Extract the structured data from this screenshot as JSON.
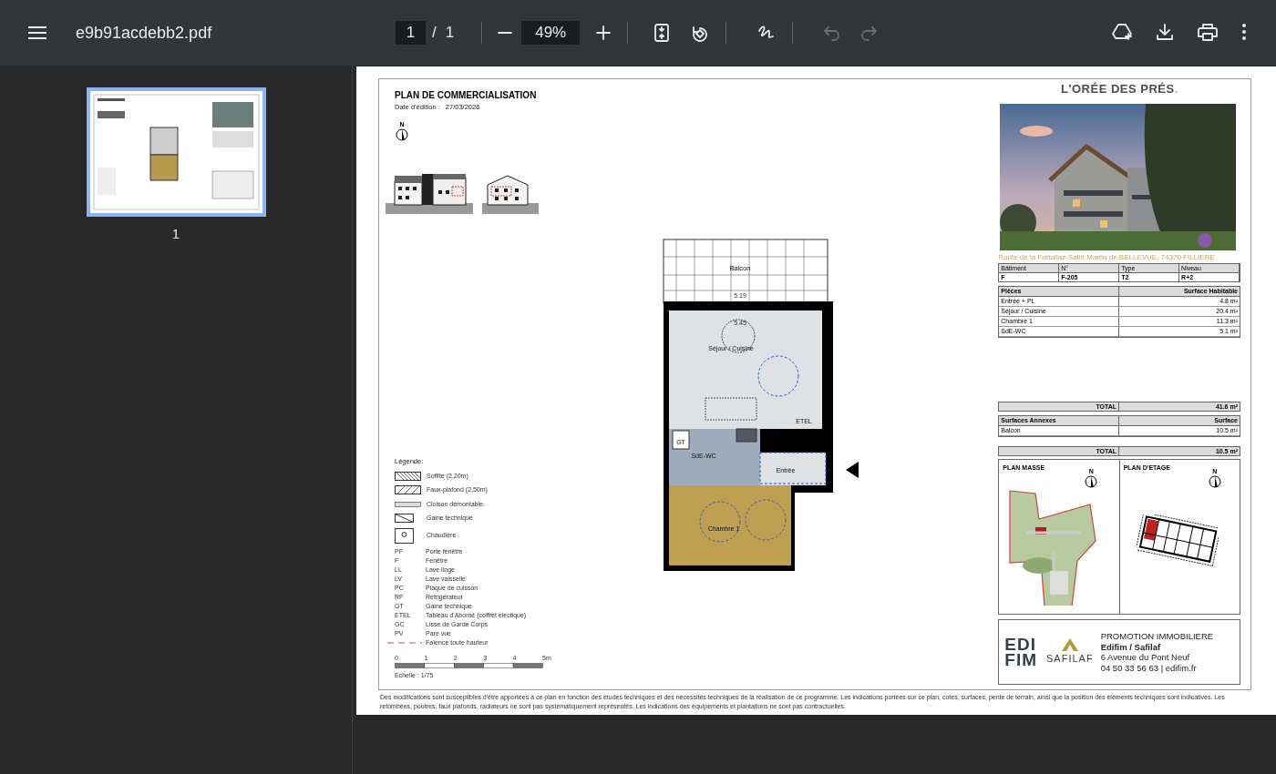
{
  "toolbar": {
    "file_name": "e9b91acdebb2.pdf",
    "page_current": "1",
    "page_separator": "/",
    "page_total": "1",
    "zoom": "49%",
    "actions": [
      {
        "kind": "fit",
        "disabled": false
      },
      {
        "kind": "rotate",
        "disabled": false
      },
      {
        "kind": "draw",
        "disabled": false
      },
      {
        "kind": "undo",
        "disabled": true
      },
      {
        "kind": "redo",
        "disabled": true
      }
    ]
  },
  "thumbnails": [
    {
      "label": "1",
      "selected": true
    }
  ],
  "document": {
    "title": "PLAN DE COMMERCIALISATION",
    "date_label": "Date d'édition :",
    "date": "27/03/2026",
    "compass": "N",
    "plan_labels": [
      {
        "kind": "room",
        "text": "Balcon"
      },
      {
        "kind": "room",
        "text": "Séjour / Cuisine"
      },
      {
        "kind": "room",
        "text": "SdE-WC"
      },
      {
        "kind": "room",
        "text": "Entrée"
      },
      {
        "kind": "room",
        "text": "Chambre 1"
      },
      {
        "kind": "code",
        "text": "GT"
      },
      {
        "kind": "code",
        "text": "ETEL"
      },
      {
        "kind": "dim",
        "text": "5.19"
      },
      {
        "kind": "dim",
        "text": "5.45"
      }
    ],
    "legend": {
      "title": "Légende:",
      "symbols": [
        {
          "kind": "dense-hatch",
          "label": "Soffite (2,20m)"
        },
        {
          "kind": "hatch",
          "label": "Faux-plafond (2,50m)"
        },
        {
          "kind": "partition",
          "label": "Cloison démontable"
        },
        {
          "kind": "duct",
          "label": "Gaine technique"
        },
        {
          "kind": "boiler",
          "label": "Chaudière"
        }
      ],
      "codes": [
        {
          "code": "PF",
          "label": "Porte fenêtre"
        },
        {
          "code": "F",
          "label": "Fenêtre"
        },
        {
          "code": "LL",
          "label": "Lave linge"
        },
        {
          "code": "LV",
          "label": "Lave vaisselle"
        },
        {
          "code": "PC",
          "label": "Plaque de cuisson"
        },
        {
          "code": "RF",
          "label": "Réfrigérateur"
        },
        {
          "code": "GT",
          "label": "Gaine technique"
        },
        {
          "code": "ETEL",
          "label": "Tableau d'Aborné (coffret électique)"
        },
        {
          "code": "GC",
          "label": "Lisse de Garde Corps"
        },
        {
          "code": "PV",
          "label": "Pare vue"
        }
      ],
      "dash_label": "Faïence toute hauteur"
    },
    "scale": {
      "ticks": [
        "0",
        "1",
        "2",
        "3",
        "4",
        "5m"
      ],
      "label": "Echelle : 1/75"
    },
    "brand": "L'ORÉE DES PRÉS",
    "brand_dot": ".",
    "address": "Route de la Frétallaz-Saint Martin de BELLEVUE, 74370 FILLIERE",
    "info_table": {
      "columns": [
        "Bâtiment",
        "N°",
        "Type",
        "Niveau"
      ],
      "values": [
        "F",
        "F-205",
        "T2",
        "R+2"
      ]
    },
    "rooms_table": {
      "columns": [
        "Pièces",
        "Surface Habitable"
      ],
      "rows": [
        [
          "Entrée + PL",
          "4.8 m²"
        ],
        [
          "Séjour / Cuisine",
          "20.4 m²"
        ],
        [
          "Chambre 1",
          "11.3 m²"
        ],
        [
          "SdE-WC",
          "5.1 m²"
        ]
      ],
      "total_label": "TOTAL",
      "total": "41.6 m²"
    },
    "annex_table": {
      "columns": [
        "Surfaces Annexes",
        "Surface"
      ],
      "rows": [
        [
          "Balcon",
          "10.5 m²"
        ]
      ],
      "total_label": "TOTAL",
      "total": "10.5 m²"
    },
    "plan_masse": {
      "title": "PLAN MASSE",
      "compass": "N"
    },
    "plan_etage": {
      "title": "PLAN D'ETAGE",
      "compass": "N"
    },
    "promoter": {
      "logo_top": "EDI",
      "logo_bottom": "FIM",
      "logo2": "SAFILAF",
      "lines": [
        "PROMOTION IMMOBILIERE",
        "Edifim / Safilaf",
        "6 Avenue du Pont Neuf",
        "04 50 33 56 63 | edifim.fr"
      ]
    },
    "disclaimer": "Des modifications sont susceptibles d'être apportées à ce plan en fonction des études techniques et des nécessités techniques de la réalisation de ce programme.   Les indications portées sur ce plan, cotes, surfaces, pente de terrain, ainsi que la position des éléments techniques sont indicatives.  Les retombées, poutres, faux plafonds, radiateurs ne sont pas systématiquement représentés. Les indications des équipements et plantations ne sont pas contractuelles."
  }
}
